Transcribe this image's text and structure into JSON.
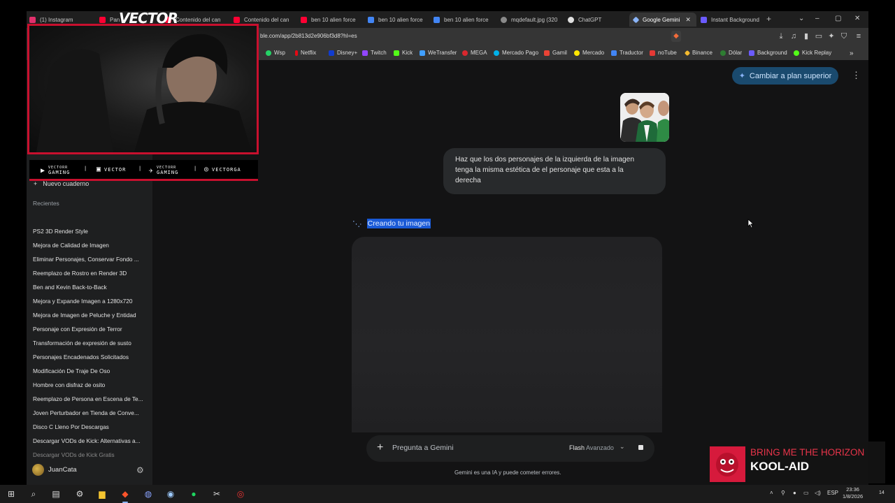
{
  "browser": {
    "tabs": [
      {
        "label": "(1) Instagram",
        "color": "#e1306c"
      },
      {
        "label": "Pan",
        "color": "#ff0033"
      },
      {
        "label": "Contenido del can",
        "color": "#ff0033"
      },
      {
        "label": "Contenido del can",
        "color": "#ff0033"
      },
      {
        "label": "ben 10 alien force",
        "color": "#ff0033"
      },
      {
        "label": "ben 10 alien force",
        "color": "#4285f4"
      },
      {
        "label": "ben 10 alien force",
        "color": "#4285f4"
      },
      {
        "label": "mqdefault.jpg (320",
        "color": "#8a8a8a"
      },
      {
        "label": "ChatGPT",
        "color": "#e0e0e0"
      },
      {
        "label": "Google Gemini",
        "color": "#8ab4f8"
      },
      {
        "label": "Instant Background",
        "color": "#6b5bff"
      }
    ],
    "active_tab_index": 9,
    "new_tab_symbol": "+",
    "url": "ble.com/app/2b813d2e906bf3d8?hl=es",
    "bookmarks": [
      {
        "label": "Wsp",
        "color": "#25d366"
      },
      {
        "label": "Netflix",
        "color": "#e50914"
      },
      {
        "label": "Disney+",
        "color": "#113ccf"
      },
      {
        "label": "Twitch",
        "color": "#9146ff"
      },
      {
        "label": "Kick",
        "color": "#53fc18"
      },
      {
        "label": "WeTransfer",
        "color": "#409fff"
      },
      {
        "label": "MEGA",
        "color": "#d9272e"
      },
      {
        "label": "Mercado Pago",
        "color": "#00b1ea"
      },
      {
        "label": "Gamil",
        "color": "#ea4335"
      },
      {
        "label": "Mercado",
        "color": "#ffe600"
      },
      {
        "label": "Traductor",
        "color": "#4285f4"
      },
      {
        "label": "noTube",
        "color": "#e53935"
      },
      {
        "label": "Binance",
        "color": "#f3ba2f"
      },
      {
        "label": "Dólar",
        "color": "#2e7d32"
      },
      {
        "label": "Background",
        "color": "#6b5bff"
      },
      {
        "label": "Kick Replay",
        "color": "#53fc18"
      }
    ]
  },
  "sidebar": {
    "new_notebook": "Nuevo cuaderno",
    "section_label": "Recientes",
    "recents": [
      "PS2 3D Render Style",
      "Mejora de Calidad de Imagen",
      "Eliminar Personajes, Conservar Fondo ...",
      "Reemplazo de Rostro en Render 3D",
      "Ben and Kevin Back-to-Back",
      "Mejora y Expande Imagen a 1280x720",
      "Mejora de Imagen de Peluche y Entidad",
      "Personaje con Expresión de Terror",
      "Transformación de expresión de susto",
      "Personajes Encadenados Solicitados",
      "Modificación De Traje De Oso",
      "Hombre con disfraz de osito",
      "Reemplazo de Persona en Escena de Te...",
      "Joven Perturbador en Tienda de Conve...",
      "Disco C Lleno Por Descargas",
      "Descargar VODs de Kick: Alternativas a...",
      "Descargar VODs de Kick Gratis"
    ],
    "user_name": "JuanCata"
  },
  "main": {
    "upgrade_label": "Cambiar a plan superior",
    "user_prompt": "Haz que los dos personajes de la izquierda de la imagen tenga la misma estética de el personaje que esta a la derecha",
    "status_text": "Creando tu imagen",
    "input_placeholder": "Pregunta a Gemini",
    "mode_label": "Flash",
    "mode_sub": "Avanzado",
    "disclaimer": "Gemini es una IA y puede cometer errores."
  },
  "overlay": {
    "logo_text": "VECTOR",
    "socials": [
      {
        "icon": "youtube-icon",
        "top": "VECTORR",
        "bottom": "GAMING"
      },
      {
        "icon": "twitch-icon",
        "top": "VECTOR",
        "bottom": ""
      },
      {
        "icon": "twitter-icon",
        "top": "VECTORR",
        "bottom": "GAMING"
      },
      {
        "icon": "instagram-icon",
        "top": "VECTORGA",
        "bottom": ""
      }
    ]
  },
  "now_playing": {
    "artist": "BRING ME THE HORIZON",
    "title": "KOOL-AID",
    "accent": "#e8344a"
  },
  "taskbar": {
    "language": "ESP",
    "time": "23:36",
    "date": "1/8/2026",
    "notification_count": "14"
  }
}
